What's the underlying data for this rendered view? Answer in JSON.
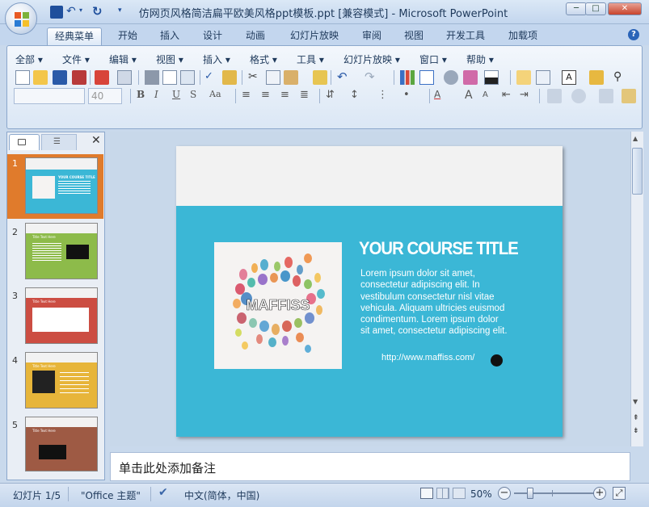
{
  "window": {
    "title": "仿网页风格简洁扁平欧美风格ppt模板.ppt [兼容模式] - Microsoft PowerPoint",
    "minimize": "─",
    "maximize": "□",
    "close": "✕"
  },
  "tabs": [
    "经典菜单",
    "开始",
    "插入",
    "设计",
    "动画",
    "幻灯片放映",
    "审阅",
    "视图",
    "开发工具",
    "加载项"
  ],
  "menus": [
    "全部 ▾",
    "文件 ▾",
    "编辑 ▾",
    "视图 ▾",
    "插入 ▾",
    "格式 ▾",
    "工具 ▾",
    "幻灯片放映 ▾",
    "窗口 ▾",
    "帮助 ▾"
  ],
  "format": {
    "font_size": "40"
  },
  "thumb_pane": {
    "numbers": [
      "1",
      "2",
      "3",
      "4",
      "5"
    ],
    "thumb_title_1": "YOUR COURSE TITLE",
    "thumb_title": "Title Text Here"
  },
  "slide": {
    "logo_text": "MAFFISS",
    "title": "YOUR COURSE TITLE",
    "body": "Lorem ipsum dolor sit amet, consectetur adipiscing elit. In vestibulum consectetur nisl vitae vehicula. Aliquam ultricies euismod condimentum. Lorem ipsum dolor sit amet, consectetur adipiscing elit.",
    "url": "http://www.maffiss.com/"
  },
  "notes": {
    "placeholder": "单击此处添加备注"
  },
  "status": {
    "slide_count": "幻灯片 1/5",
    "theme": "\"Office 主题\"",
    "language": "中文(简体，中国)",
    "zoom": "50%"
  },
  "colors": {
    "slide_bg": "#3bb7d6",
    "accent": "#e07b2c"
  }
}
